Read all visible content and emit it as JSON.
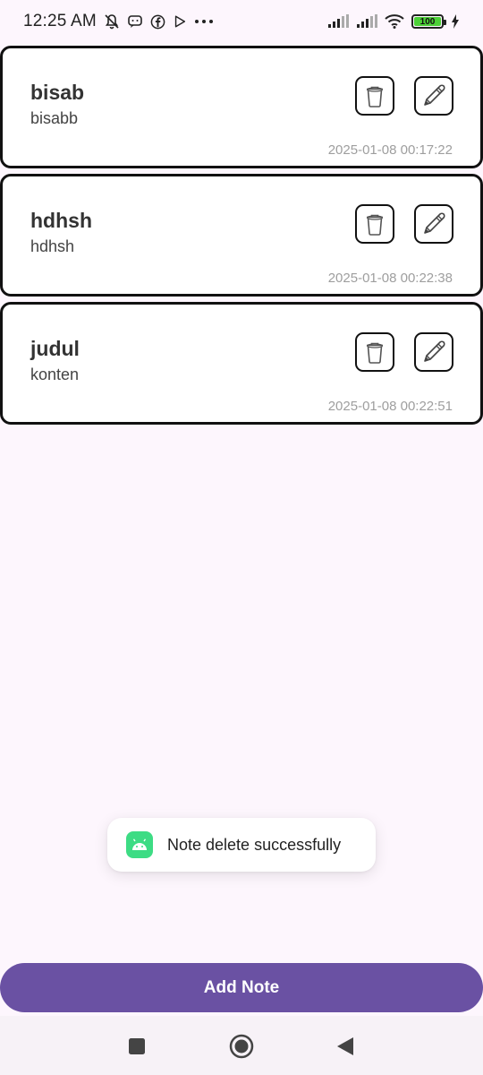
{
  "status_bar": {
    "time": "12:25 AM",
    "left_icons": [
      "mute-bell-icon",
      "chat-bubble-icon",
      "facebook-icon",
      "play-store-icon",
      "more-dots-icon"
    ],
    "right_icons": [
      "signal-icon",
      "signal-icon",
      "wifi-icon",
      "battery-icon",
      "charging-icon"
    ],
    "battery_level": "100"
  },
  "notes": [
    {
      "title": "bisab",
      "content": "bisabb",
      "date": "2025-01-08 00:17:22"
    },
    {
      "title": "hdhsh",
      "content": "hdhsh",
      "date": "2025-01-08 00:22:38"
    },
    {
      "title": "judul",
      "content": "konten",
      "date": "2025-01-08 00:22:51"
    }
  ],
  "note_actions": {
    "delete_icon": "trash-icon",
    "edit_icon": "pencil-icon"
  },
  "toast": {
    "app_icon": "android-icon",
    "message": "Note delete successfully"
  },
  "add_button": {
    "label": "Add Note"
  },
  "nav_bar": {
    "items": [
      "recents-square-icon",
      "home-circle-icon",
      "back-triangle-icon"
    ]
  },
  "colors": {
    "background": "#fdf6fd",
    "primary": "#6a51a3",
    "card_border": "#111111",
    "date_text": "#9e9e9e",
    "toast_icon": "#3ddc84"
  }
}
